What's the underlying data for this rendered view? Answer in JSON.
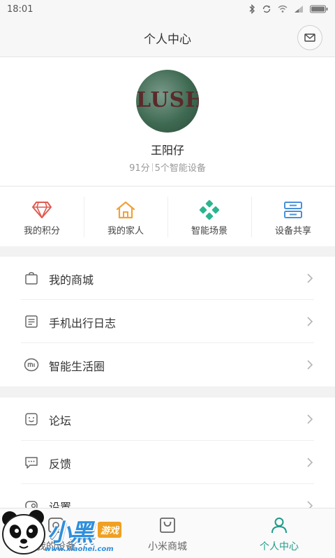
{
  "status_bar": {
    "time": "18:01",
    "icons": [
      "bluetooth-icon",
      "sync-icon",
      "wifi-icon",
      "signal-icon",
      "battery-icon"
    ]
  },
  "header": {
    "title": "个人中心",
    "mail_icon": "mail-icon"
  },
  "profile": {
    "avatar_text": "LUSH",
    "name": "王阳仔",
    "points": "91分",
    "devices": "5个智能设备"
  },
  "quick_actions": [
    {
      "label": "我的积分",
      "icon": "diamond-icon",
      "color": "#e05a4f"
    },
    {
      "label": "我的家人",
      "icon": "home-icon",
      "color": "#f0a23a"
    },
    {
      "label": "智能场景",
      "icon": "scene-icon",
      "color": "#2bb58f"
    },
    {
      "label": "设备共享",
      "icon": "share-icon",
      "color": "#4a90d9"
    }
  ],
  "menu_group_1": [
    {
      "label": "我的商城",
      "icon": "bag-icon"
    },
    {
      "label": "手机出行日志",
      "icon": "log-icon"
    },
    {
      "label": "智能生活圈",
      "icon": "mi-circle-icon"
    }
  ],
  "menu_group_2": [
    {
      "label": "论坛",
      "icon": "forum-icon"
    },
    {
      "label": "反馈",
      "icon": "feedback-icon"
    },
    {
      "label": "设置",
      "icon": "settings-icon"
    }
  ],
  "bottom_nav": [
    {
      "label": "我的设备",
      "icon": "device-icon",
      "active": false
    },
    {
      "label": "小米商城",
      "icon": "shop-icon",
      "active": false
    },
    {
      "label": "个人中心",
      "icon": "person-icon",
      "active": true
    }
  ],
  "colors": {
    "accent": "#1e9c88",
    "watermark_blue": "#2f8fdc"
  },
  "watermark": {
    "logo_text": "小黑",
    "tag": "游戏",
    "url": "www.xiaohei.com"
  }
}
